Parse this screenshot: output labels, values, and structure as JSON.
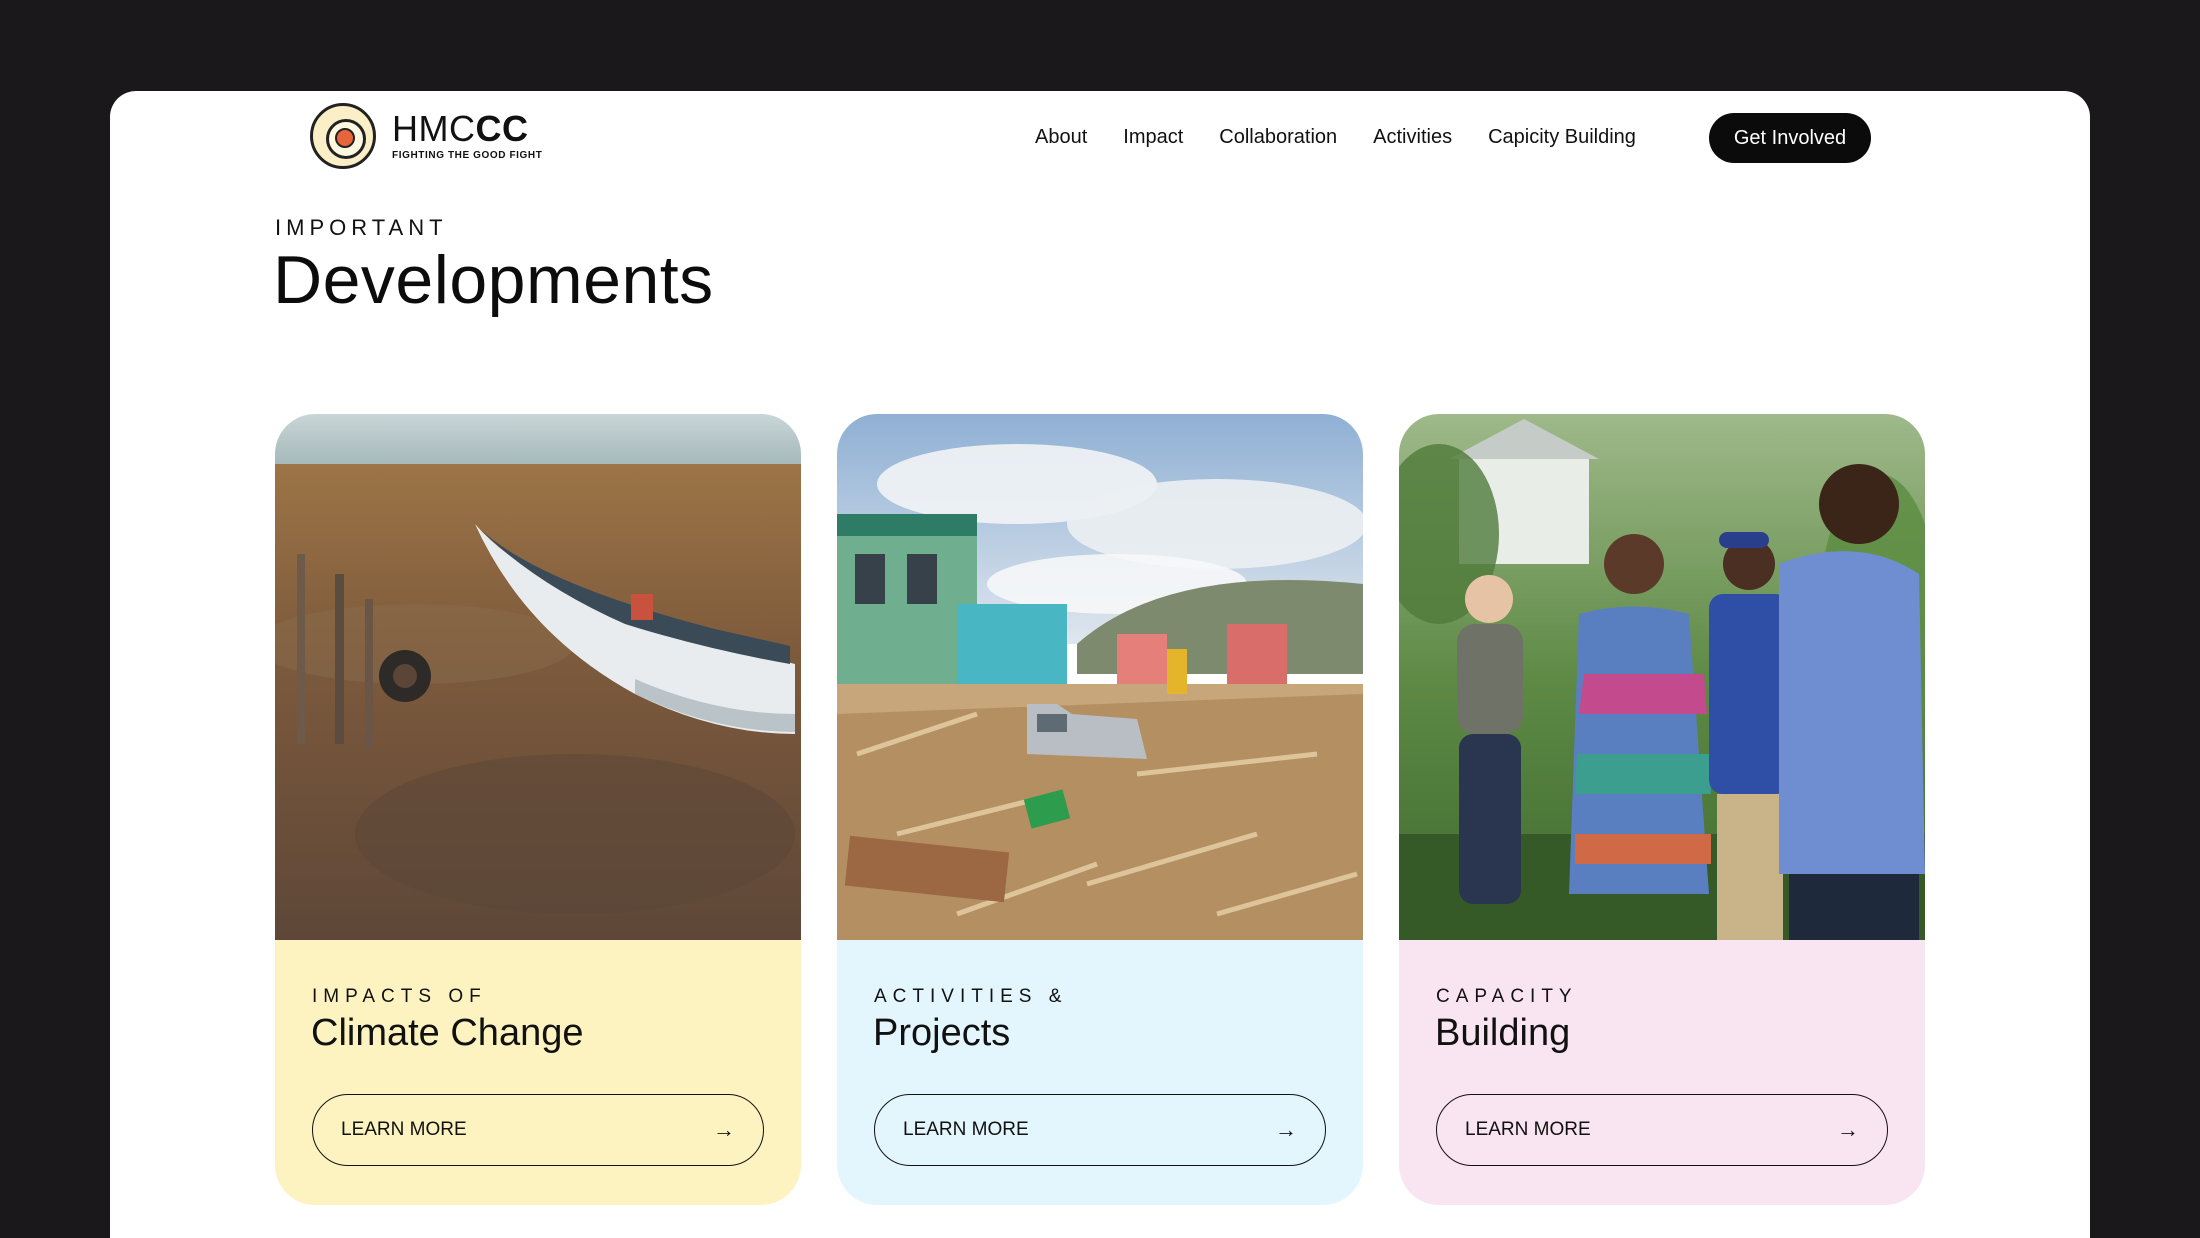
{
  "brand": {
    "name_light": "HMC",
    "name_bold": "CC",
    "tagline": "FIGHTING THE GOOD FIGHT"
  },
  "nav": {
    "items": [
      {
        "label": "About"
      },
      {
        "label": "Impact"
      },
      {
        "label": "Collaboration"
      },
      {
        "label": "Activities"
      },
      {
        "label": "Capicity Building"
      }
    ],
    "cta": "Get Involved"
  },
  "section": {
    "eyebrow": "IMPORTANT",
    "title": "Developments"
  },
  "cards": [
    {
      "eyebrow": "IMPACTS OF",
      "title": "Climate Change",
      "button": "LEARN MORE",
      "bg": "#fdf3c0"
    },
    {
      "eyebrow": "ACTIVITIES &",
      "title": "Projects",
      "button": "LEARN MORE",
      "bg": "#e3f6fd"
    },
    {
      "eyebrow": "CAPACITY",
      "title": "Building",
      "button": "LEARN MORE",
      "bg": "#f9e5f1"
    }
  ],
  "colors": {
    "frame": "#1a181b",
    "cta_bg": "#0b0b0b",
    "logo_accent": "#e8643b"
  }
}
